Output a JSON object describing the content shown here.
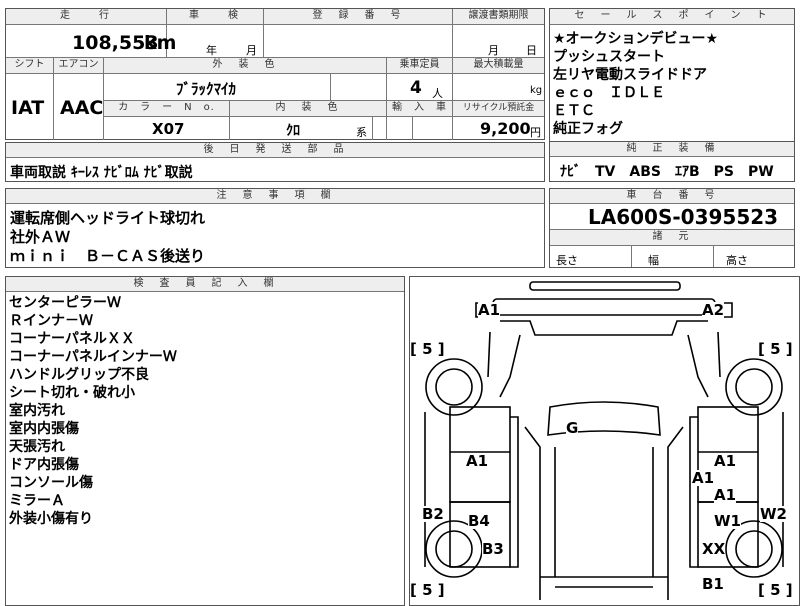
{
  "top": {
    "h_mileage": "走　　行",
    "h_inspection": "車　　検",
    "h_registration": "登　録　番　号",
    "h_transfer": "譲渡書類期限",
    "h_shift": "シフト",
    "h_aircon": "エアコン",
    "h_exterior": "外　装　色",
    "h_capacity": "乗車定員",
    "h_load": "最大積載量",
    "h_color_no": "カ　ラ　ー　N　o.",
    "h_interior": "内　装　色",
    "h_import": "輸　入　車",
    "h_recycle": "リサイクル預託金",
    "mileage": "108,553",
    "mileage_unit": "km",
    "insp_year": "年",
    "insp_month": "月",
    "transfer_month": "月",
    "transfer_day": "日",
    "shift": "IAT",
    "aircon": "AAC",
    "exterior_color": "ﾌﾞﾗｯｸﾏｲｶ",
    "capacity": "4",
    "capacity_unit": "人",
    "load_unit": "kg",
    "color_no": "X07",
    "interior_color": "ｸﾛ",
    "interior_suffix": "系",
    "recycle": "9,200",
    "recycle_unit": "円"
  },
  "accessories": {
    "header": "後　日　発　送　部　品",
    "text": "車両取説 ｷｰﾚｽ ﾅﾋﾞﾛﾑ ﾅﾋﾞ取説"
  },
  "notes": {
    "header": "注　意　事　項　欄",
    "lines": [
      "運転席側ヘッドライト球切れ",
      "社外ＡＷ",
      "ｍｉｎｉ　Ｂ－ＣＡＳ後送り"
    ]
  },
  "inspector": {
    "header": "検　査　員　記　入　欄",
    "lines": [
      "センターピラーＷ",
      "Ｒインナ－Ｗ",
      "コーナーパネルＸＸ",
      "コーナーパネルインナーＷ",
      "ハンドルグリップ不良",
      "シート切れ・破れ小",
      "室内汚れ",
      "室内内張傷",
      "天張汚れ",
      "ドア内張傷",
      "コンソール傷",
      "ミラーＡ",
      "外装小傷有り"
    ]
  },
  "sales": {
    "header": "セ　ー　ル　ス　ポ　イ　ン　ト",
    "lines": [
      "★オークションデビュー★",
      "プッシュスタート",
      "左リヤ電動スライドドア",
      "ｅｃｏ　ＩＤＬＥ",
      "ＥＴＣ",
      "純正フォグ"
    ]
  },
  "equipment": {
    "header": "純　正　装　備",
    "text": "ﾅﾋﾞ　TV　ABS　ｴｱB　PS　PW"
  },
  "chassis": {
    "header": "車　台　番　号",
    "value": "LA600S-0395523"
  },
  "dimensions": {
    "header": "諸　元",
    "length": "長さ",
    "width": "幅",
    "height": "高さ"
  },
  "diagram": {
    "a1_front_left": "A1",
    "a2_front_right": "A2",
    "tire_fl": "[ 5 ]",
    "tire_fr": "[ 5 ]",
    "tire_rl": "[ 5 ]",
    "tire_rr": "[ 5 ]",
    "g_windshield": "G",
    "a1_left_door": "A1",
    "a1_right_door_upper": "A1",
    "a1_right_pillar": "A1",
    "a1_right_door_lower": "A1",
    "b2_left": "B2",
    "b4_left": "B4",
    "w1_right": "W1",
    "w2_right": "W2",
    "b3_left": "B3",
    "xx_right": "XX",
    "b1_right": "B1"
  }
}
